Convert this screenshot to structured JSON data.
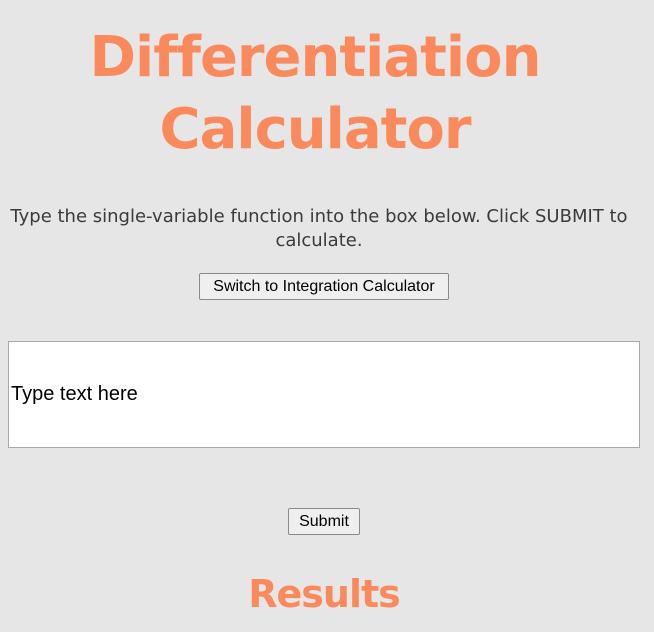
{
  "header": {
    "title_line1": "Differentiation",
    "title_line2": "Calculator"
  },
  "instructions": {
    "line1": "Type the single-variable function into the box below. Click SUBMIT to",
    "line2": "calculate."
  },
  "switch_button": {
    "label": "Switch to Integration Calculator"
  },
  "function_input": {
    "value": "",
    "placeholder": "Type text here"
  },
  "submit_button": {
    "label": "Submit"
  },
  "results": {
    "heading": "Results"
  },
  "colors": {
    "accent": "#fa8a5c",
    "background": "#e6e6e6",
    "text": "#3a3a3a"
  }
}
